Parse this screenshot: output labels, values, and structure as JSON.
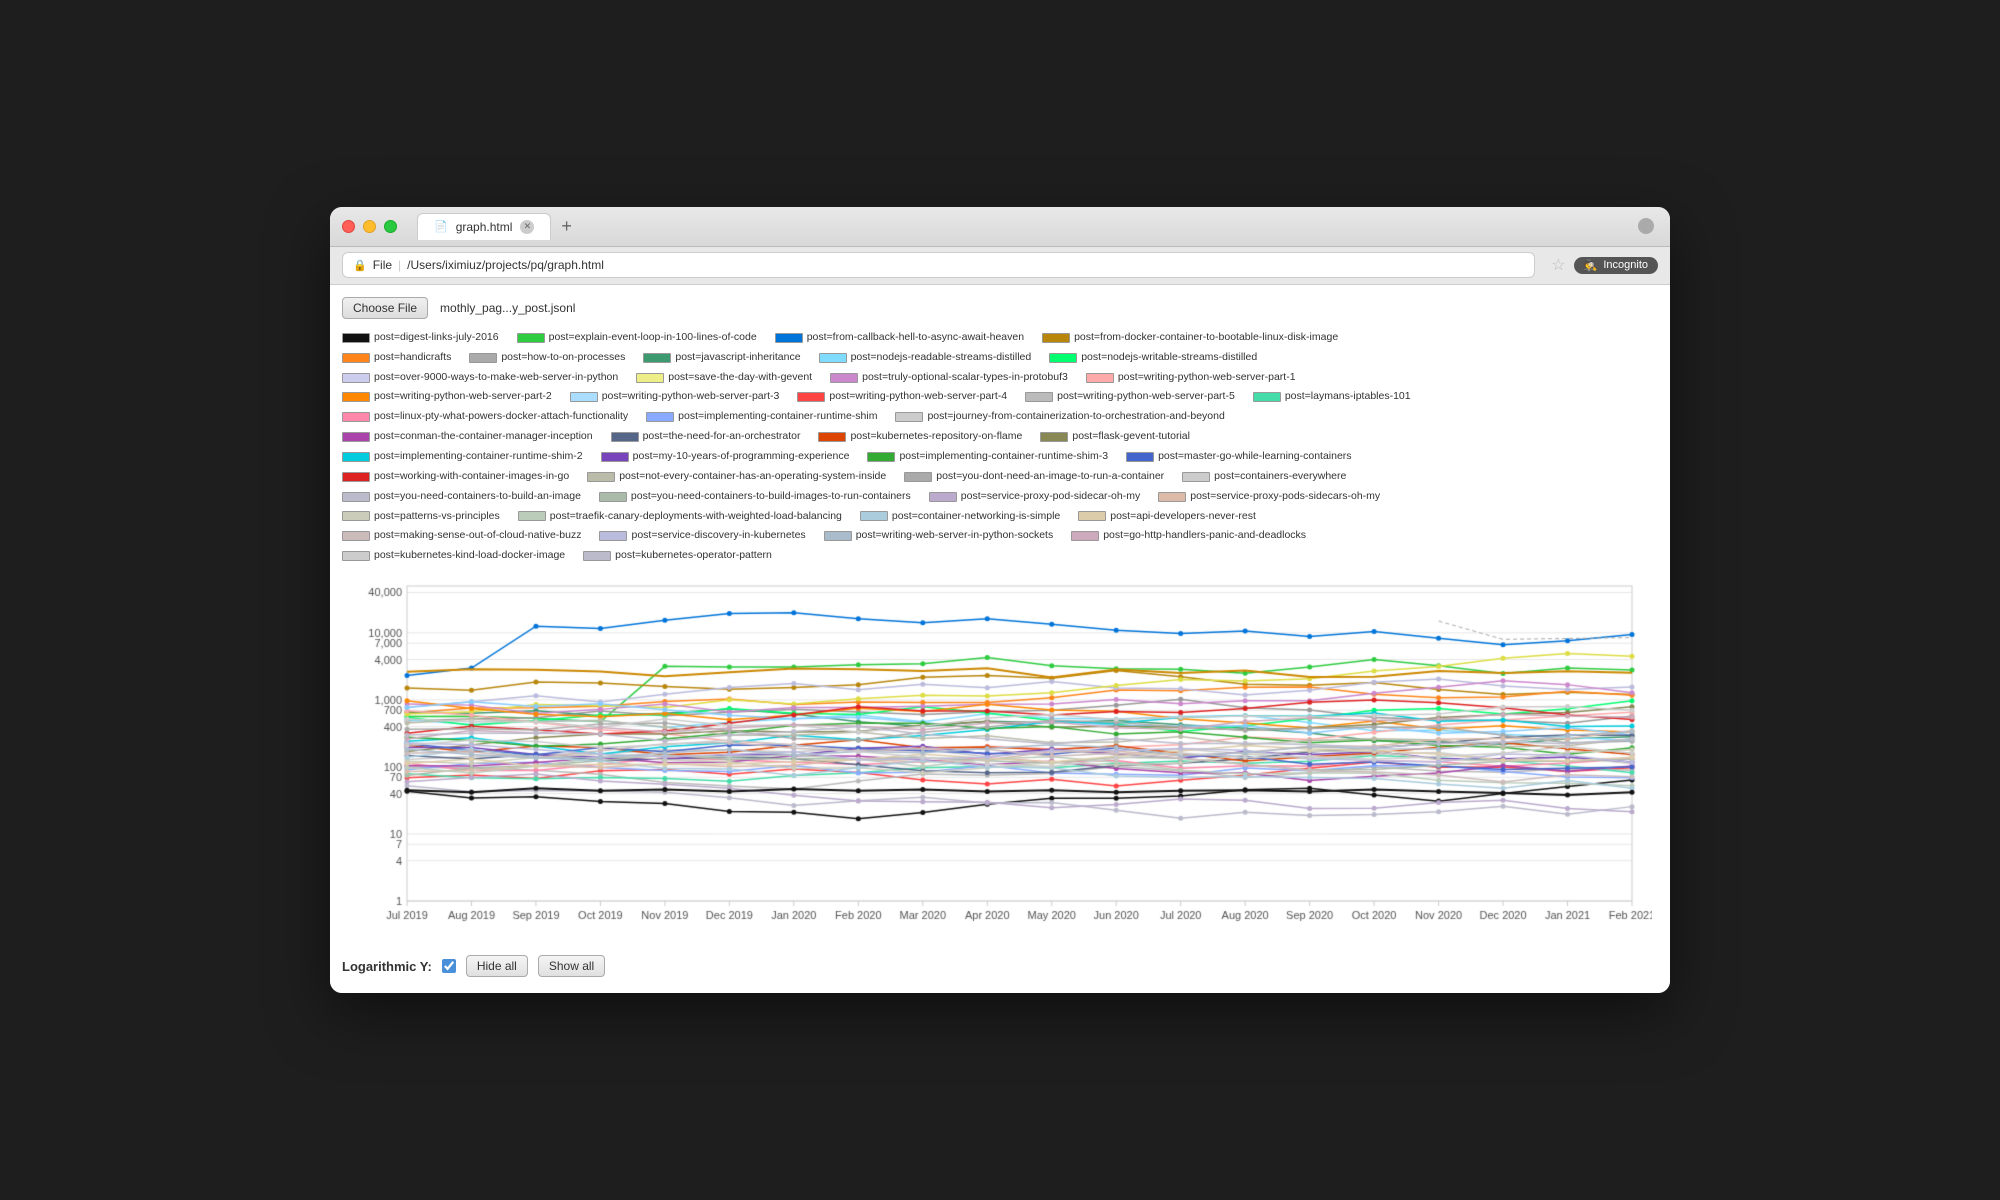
{
  "window": {
    "title": "graph.html",
    "url_protocol": "File",
    "url_path": "/Users/iximiuz/projects/pq/graph.html",
    "incognito_label": "Incognito"
  },
  "toolbar": {
    "choose_file_label": "Choose File",
    "filename": "mothly_pag...y_post.jsonl"
  },
  "controls": {
    "log_y_label": "Logarithmic Y:",
    "hide_all_label": "Hide all",
    "show_all_label": "Show all"
  },
  "legend_items": [
    {
      "label": "post=digest-links-july-2016",
      "color": "#111111",
      "border": true
    },
    {
      "label": "post=explain-event-loop-in-100-lines-of-code",
      "color": "#2ecc40",
      "border": true
    },
    {
      "label": "post=from-callback-hell-to-async-await-heaven",
      "color": "#0074d9",
      "border": true
    },
    {
      "label": "post=from-docker-container-to-bootable-linux-disk-image",
      "color": "#b8860b",
      "border": true
    },
    {
      "label": "post=handicrafts",
      "color": "#ff851b",
      "border": true
    },
    {
      "label": "post=how-to-on-processes",
      "color": "#aaaaaa",
      "border": true
    },
    {
      "label": "post=javascript-inheritance",
      "color": "#3d9970",
      "border": true
    },
    {
      "label": "post=nodejs-readable-streams-distilled",
      "color": "#7fdbff",
      "border": true
    },
    {
      "label": "post=nodejs-writable-streams-distilled",
      "color": "#01ff70",
      "border": true
    },
    {
      "label": "post=over-9000-ways-to-make-web-server-in-python",
      "color": "#ccccee",
      "border": true
    },
    {
      "label": "post=save-the-day-with-gevent",
      "color": "#eeee88",
      "border": true
    },
    {
      "label": "post=truly-optional-scalar-types-in-protobuf3",
      "color": "#cc88cc",
      "border": true
    },
    {
      "label": "post=writing-python-web-server-part-1",
      "color": "#ffaaaa",
      "border": true
    },
    {
      "label": "post=writing-python-web-server-part-2",
      "color": "#ff8800",
      "border": true
    },
    {
      "label": "post=writing-python-web-server-part-3",
      "color": "#aaddff",
      "border": true
    },
    {
      "label": "post=writing-python-web-server-part-4",
      "color": "#ff4444",
      "border": true
    },
    {
      "label": "post=writing-python-web-server-part-5",
      "color": "#bbbbbb",
      "border": true
    },
    {
      "label": "post=laymans-iptables-101",
      "color": "#44ddaa",
      "border": true
    },
    {
      "label": "post=linux-pty-what-powers-docker-attach-functionality",
      "color": "#ff88aa",
      "border": true
    },
    {
      "label": "post=implementing-container-runtime-shim",
      "color": "#88aaff",
      "border": true
    },
    {
      "label": "post=journey-from-containerization-to-orchestration-and-beyond",
      "color": "#cccccc",
      "border": true
    },
    {
      "label": "post=conman-the-container-manager-inception",
      "color": "#aa44aa",
      "border": true
    },
    {
      "label": "post=the-need-for-an-orchestrator",
      "color": "#556688",
      "border": true
    },
    {
      "label": "post=kubernetes-repository-on-flame",
      "color": "#dd4400",
      "border": true
    },
    {
      "label": "post=flask-gevent-tutorial",
      "color": "#888855",
      "border": true
    },
    {
      "label": "post=implementing-container-runtime-shim-2",
      "color": "#00ccdd",
      "border": true
    },
    {
      "label": "post=my-10-years-of-programming-experience",
      "color": "#7744bb",
      "border": true
    },
    {
      "label": "post=implementing-container-runtime-shim-3",
      "color": "#33aa33",
      "border": true
    },
    {
      "label": "post=master-go-while-learning-containers",
      "color": "#4466cc",
      "border": true
    },
    {
      "label": "post=working-with-container-images-in-go",
      "color": "#dd2222",
      "border": true
    },
    {
      "label": "post=not-every-container-has-an-operating-system-inside",
      "color": "#bbbbaa",
      "border": true
    },
    {
      "label": "post=you-dont-need-an-image-to-run-a-container",
      "color": "#aaaaaa",
      "border": true
    },
    {
      "label": "post=containers-everywhere",
      "color": "#cccccc",
      "border": true
    },
    {
      "label": "post=you-need-containers-to-build-an-image",
      "color": "#bbbbcc",
      "border": true
    },
    {
      "label": "post=you-need-containers-to-build-images-to-run-containers",
      "color": "#aabbaa",
      "border": true
    },
    {
      "label": "post=service-proxy-pod-sidecar-oh-my",
      "color": "#bbaacc",
      "border": true
    },
    {
      "label": "post=service-proxy-pods-sidecars-oh-my",
      "color": "#ddbbaa",
      "border": true
    },
    {
      "label": "post=patterns-vs-principles",
      "color": "#ccccbb",
      "border": true
    },
    {
      "label": "post=traefik-canary-deployments-with-weighted-load-balancing",
      "color": "#bbccbb",
      "border": true
    },
    {
      "label": "post=container-networking-is-simple",
      "color": "#aaccdd",
      "border": true
    },
    {
      "label": "post=api-developers-never-rest",
      "color": "#ddccaa",
      "border": true
    },
    {
      "label": "post=making-sense-out-of-cloud-native-buzz",
      "color": "#ccbbbb",
      "border": true
    },
    {
      "label": "post=service-discovery-in-kubernetes",
      "color": "#bbbbdd",
      "border": true
    },
    {
      "label": "post=writing-web-server-in-python-sockets",
      "color": "#aabbcc",
      "border": true
    },
    {
      "label": "post=go-http-handlers-panic-and-deadlocks",
      "color": "#ccaabb",
      "border": true
    },
    {
      "label": "post=kubernetes-kind-load-docker-image",
      "color": "#cccccc",
      "border": true
    },
    {
      "label": "post=kubernetes-operator-pattern",
      "color": "#bbbbcc",
      "border": true
    }
  ],
  "chart": {
    "x_labels": [
      "Jul 2019",
      "Aug 2019",
      "Sep 2019",
      "Oct 2019",
      "Nov 2019",
      "Dec 2019",
      "Jan 2020",
      "Feb 2020",
      "Mar 2020",
      "Apr 2020",
      "May 2020",
      "Jun 2020",
      "Jul 2020",
      "Aug 2020",
      "Sep 2020",
      "Oct 2020",
      "Nov 2020",
      "Dec 2020",
      "Jan 2021",
      "Feb 2021"
    ],
    "y_labels": [
      "40,000",
      "10,000",
      "7,000",
      "4,000",
      "1,000",
      "700",
      "400",
      "100",
      "70",
      "40",
      "10",
      "7",
      "4",
      "1"
    ],
    "y_log_values": [
      40000,
      10000,
      7000,
      4000,
      1000,
      700,
      400,
      100,
      70,
      40,
      10,
      7,
      4,
      1
    ]
  }
}
